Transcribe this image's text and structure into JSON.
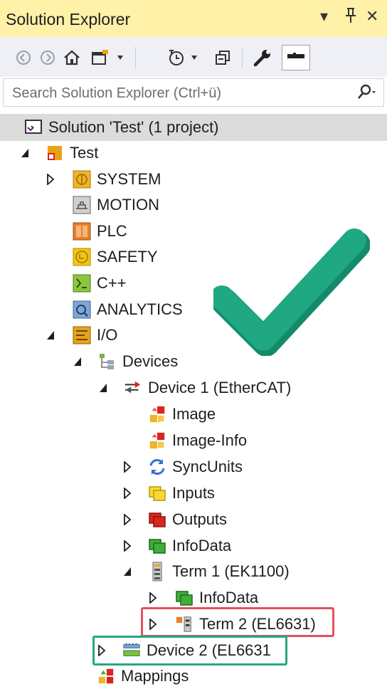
{
  "window": {
    "title": "Solution Explorer",
    "controls": [
      "▾",
      "⊥",
      "✕"
    ]
  },
  "toolbar": {
    "icons": [
      "back-icon",
      "forward-icon",
      "home-icon",
      "switch-views-icon",
      "dropdown-icon",
      "pending-changes-filter-icon",
      "dropdown-icon",
      "collapse-all-icon",
      "properties-wrench-icon",
      "preview-selected-items-icon"
    ]
  },
  "search": {
    "placeholder": "Search Solution Explorer (Ctrl+ü)"
  },
  "tree": {
    "solution": "Solution 'Test' (1 project)",
    "project": "Test",
    "system": "SYSTEM",
    "motion": "MOTION",
    "plc": "PLC",
    "safety": "SAFETY",
    "cpp": "C++",
    "analytics": "ANALYTICS",
    "io": "I/O",
    "devices": "Devices",
    "device1": "Device 1 (EtherCAT)",
    "image": "Image",
    "image_info": "Image-Info",
    "syncunits": "SyncUnits",
    "inputs": "Inputs",
    "outputs": "Outputs",
    "infodata": "InfoData",
    "term1": "Term 1 (EK1100)",
    "term1_infodata": "InfoData",
    "term2": "Term 2 (EL6631)",
    "device2": "Device 2 (EL6631",
    "mappings": "Mappings"
  },
  "colors": {
    "title_bar": "#fff1a8",
    "highlight_red": "#e45060",
    "highlight_green": "#26a883",
    "checkmark": "#1fa882"
  }
}
